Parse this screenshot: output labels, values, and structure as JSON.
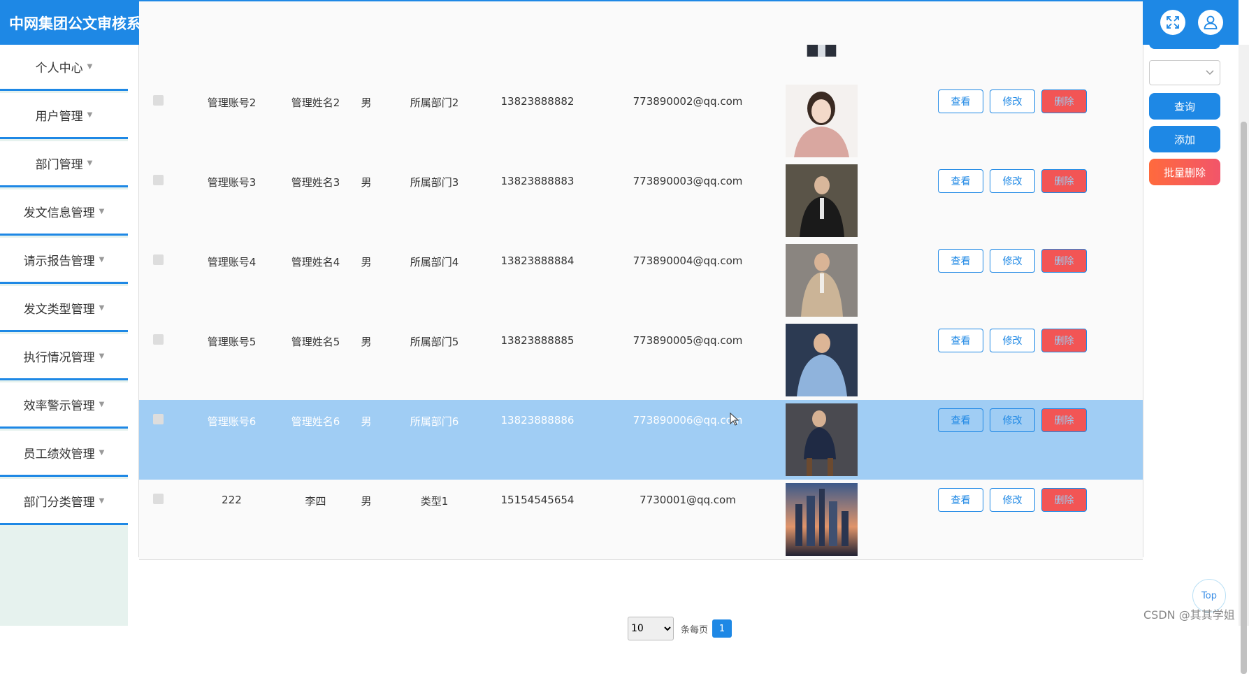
{
  "header": {
    "title": "中网集团公文审核系统-公文统计与分析子系统",
    "icons": [
      "fullscreen-icon",
      "user-icon"
    ]
  },
  "sidebar": {
    "items": [
      {
        "label": "个人中心"
      },
      {
        "label": "用户管理"
      },
      {
        "label": "部门管理"
      },
      {
        "label": "发文信息管理"
      },
      {
        "label": "请示报告管理"
      },
      {
        "label": "发文类型管理"
      },
      {
        "label": "执行情况管理"
      },
      {
        "label": "效率警示管理"
      },
      {
        "label": "员工绩效管理"
      },
      {
        "label": "部门分类管理"
      }
    ]
  },
  "actions": {
    "view": "查看",
    "edit": "修改",
    "delete": "删除"
  },
  "table": {
    "rows": [
      {
        "account": "管理账号2",
        "name": "管理姓名2",
        "gender": "男",
        "dept": "所属部门2",
        "phone": "13823888882",
        "email": "773890002@qq.com",
        "selected": false,
        "photo": "woman-portrait"
      },
      {
        "account": "管理账号3",
        "name": "管理姓名3",
        "gender": "男",
        "dept": "所属部门3",
        "phone": "13823888883",
        "email": "773890003@qq.com",
        "selected": false,
        "photo": "man-dark-suit"
      },
      {
        "account": "管理账号4",
        "name": "管理姓名4",
        "gender": "男",
        "dept": "所属部门4",
        "phone": "13823888884",
        "email": "773890004@qq.com",
        "selected": false,
        "photo": "man-beige-suit"
      },
      {
        "account": "管理账号5",
        "name": "管理姓名5",
        "gender": "男",
        "dept": "所属部门5",
        "phone": "13823888885",
        "email": "773890005@qq.com",
        "selected": false,
        "photo": "man-blue-shirt"
      },
      {
        "account": "管理账号6",
        "name": "管理姓名6",
        "gender": "男",
        "dept": "所属部门6",
        "phone": "13823888886",
        "email": "773890006@qq.com",
        "selected": true,
        "photo": "man-seated"
      },
      {
        "account": "222",
        "name": "李四",
        "gender": "男",
        "dept": "类型1",
        "phone": "15154545654",
        "email": "7730001@qq.com",
        "selected": false,
        "photo": "city-skyline"
      }
    ]
  },
  "right_panel": {
    "search": "查询",
    "add": "添加",
    "batch_delete": "批量删除"
  },
  "pagination": {
    "page_size": "10",
    "per_page_label": "条每页",
    "current_page": "1"
  },
  "top_button": "Top",
  "watermark": "CSDN @其其学姐",
  "colors": {
    "primary": "#1e88e5",
    "danger": "#f25555",
    "selected_row": "#a0cdf4"
  }
}
